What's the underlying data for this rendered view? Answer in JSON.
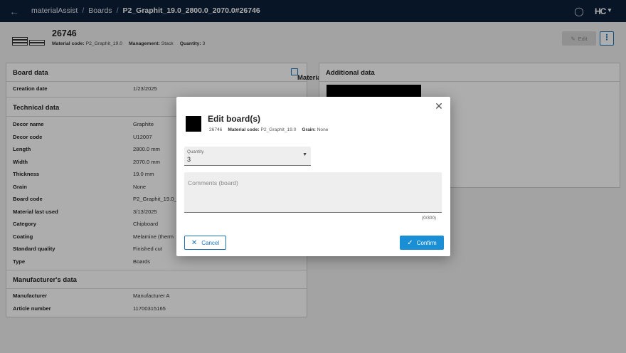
{
  "topbar": {
    "app_name": "materialAssist",
    "crumb_boards": "Boards",
    "crumb_current": "P2_Graphit_19.0_2800.0_2070.0#26746",
    "logo": "HC"
  },
  "header": {
    "title": "26746",
    "material_code_label": "Material code:",
    "material_code_value": "P2_Graphit_19.0",
    "management_label": "Management:",
    "management_value": "Stack",
    "quantity_label": "Quantity:",
    "quantity_value": "3",
    "edit_label": "Edit"
  },
  "board_data": {
    "title": "Board data",
    "link_label": "MaterialManager",
    "rows": [
      {
        "label": "Creation date",
        "value": "1/23/2025"
      }
    ]
  },
  "technical_data": {
    "title": "Technical data",
    "rows": [
      {
        "label": "Decor name",
        "value": "Graphite"
      },
      {
        "label": "Decor code",
        "value": "U12007"
      },
      {
        "label": "Length",
        "value": "2800.0 mm"
      },
      {
        "label": "Width",
        "value": "2070.0 mm"
      },
      {
        "label": "Thickness",
        "value": "19.0 mm"
      },
      {
        "label": "Grain",
        "value": "None"
      },
      {
        "label": "Board code",
        "value": "P2_Graphit_19.0_2"
      },
      {
        "label": "Material last used",
        "value": "3/13/2025"
      },
      {
        "label": "Category",
        "value": "Chipboard"
      },
      {
        "label": "Coating",
        "value": "Melamine (therm"
      },
      {
        "label": "Standard quality",
        "value": "Finished cut"
      },
      {
        "label": "Type",
        "value": "Boards"
      }
    ]
  },
  "manufacturer_data": {
    "title": "Manufacturer's data",
    "rows": [
      {
        "label": "Manufacturer",
        "value": "Manufacturer A"
      },
      {
        "label": "Article number",
        "value": "11700315165"
      }
    ]
  },
  "additional_data": {
    "title": "Additional data"
  },
  "dialog": {
    "title": "Edit board(s)",
    "id": "26746",
    "material_code_label": "Material code:",
    "material_code_value": "P2_Graphit_19.0",
    "grain_label": "Grain:",
    "grain_value": "None",
    "quantity_label": "Quantity",
    "quantity_value": "3",
    "comments_placeholder": "Comments (board)",
    "comments_value": "",
    "counter": "(0/300)",
    "cancel_label": "Cancel",
    "confirm_label": "Confirm"
  },
  "colors": {
    "topbar": "#0b1f3a",
    "accent": "#1a73b8",
    "confirm": "#1a8fd6"
  }
}
